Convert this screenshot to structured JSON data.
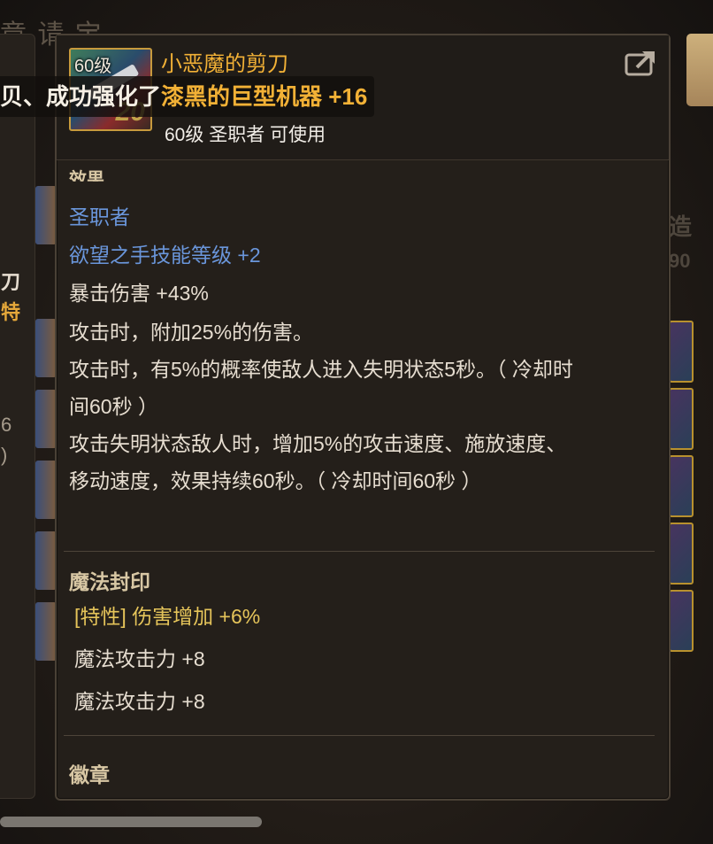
{
  "background": {
    "title_fragment": "章 请 宝",
    "left_fragments": [
      "刀",
      "特",
      "6",
      ")"
    ],
    "right_ghost_1": "造",
    "right_ghost_2": "90"
  },
  "tooltip": {
    "icon_level": "60级",
    "icon_plus": "20",
    "item_name": "小恶魔的剪刀",
    "requirement": "60级 圣职者 可使用",
    "effects_label": "效果",
    "effects": {
      "class_line": "圣职者",
      "skill_line": "欲望之手技能等级 +2",
      "crit_line": "暴击伤害 +43%",
      "attack_dmg_line": "攻击时，附加25%的伤害。",
      "blind_line_1": "攻击时，有5%的概率使敌人进入失明状态5秒。（ 冷却时",
      "blind_line_2": "间60秒 ）",
      "speed_line_1": "攻击失明状态敌人时，增加5%的攻击速度、施放速度、",
      "speed_line_2": "移动速度，效果持续60秒。（ 冷却时间60秒 ）"
    },
    "magic_seal": {
      "label": "魔法封印",
      "trait_line": "[特性] 伤害增加 +6%",
      "stat_1": "魔法攻击力 +8",
      "stat_2": "魔法攻击力 +8"
    },
    "emblem_label": "徽章"
  },
  "banner": {
    "prefix": "贝、成功强化了",
    "item": "漆黑的巨型机器 +16"
  },
  "colors": {
    "item_name": "#f2b136",
    "blue_text": "#6a96db",
    "gold_text": "#e5c45a",
    "panel_bg": "#241f1a"
  },
  "icons": {
    "share": "share-export-icon"
  }
}
